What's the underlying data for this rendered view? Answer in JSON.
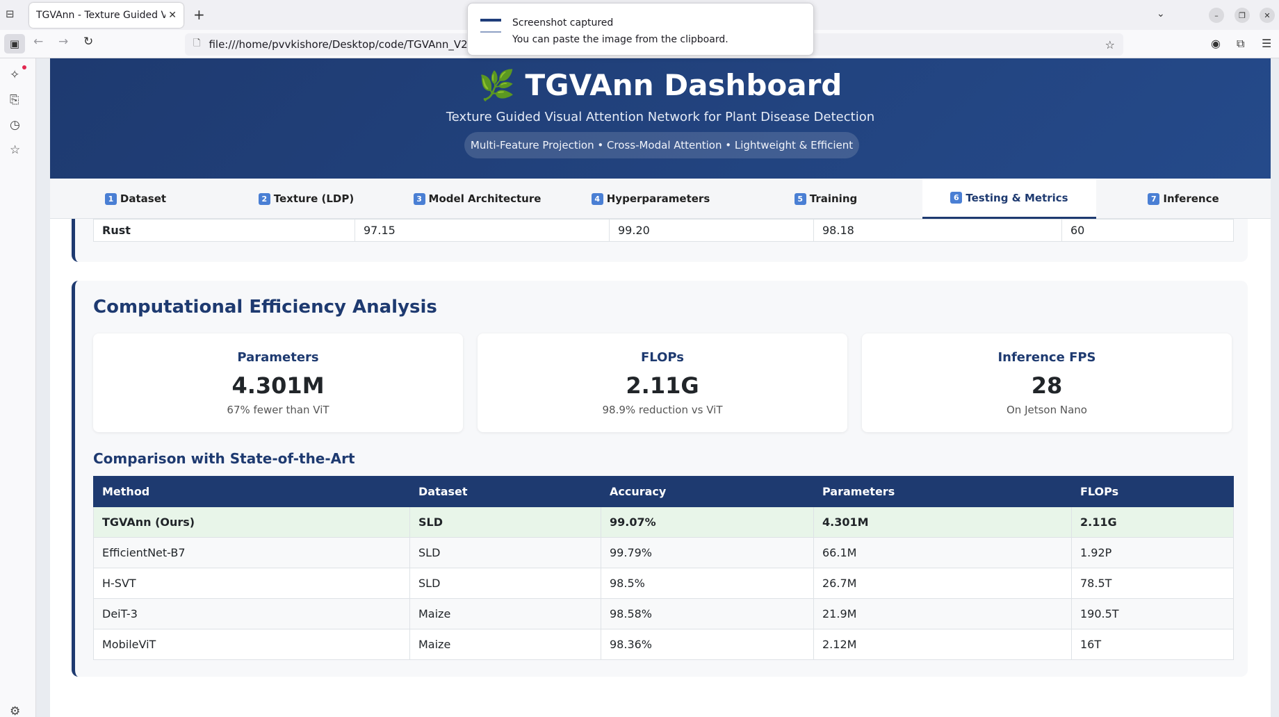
{
  "browser": {
    "tab_title": "TGVAnn - Texture Guided Vis",
    "url": "file:///home/pvvkishore/Desktop/code/TGVAnn_V2_K",
    "icons": [
      "tab-list-icon",
      "close-icon",
      "new-tab-icon",
      "back-icon",
      "forward-icon",
      "reload-icon",
      "page-icon",
      "bookmark-star-icon",
      "account-icon",
      "extensions-icon",
      "menu-icon"
    ]
  },
  "notification": {
    "title": "Screenshot captured",
    "body": "You can paste the image from the clipboard."
  },
  "header": {
    "title": "🌿 TGVAnn Dashboard",
    "subtitle": "Texture Guided Visual Attention Network for Plant Disease Detection",
    "pill": "Multi-Feature Projection • Cross-Modal Attention • Lightweight & Efficient"
  },
  "tabs": [
    {
      "num": "1",
      "label": "Dataset"
    },
    {
      "num": "2",
      "label": "Texture (LDP)"
    },
    {
      "num": "3",
      "label": "Model Architecture"
    },
    {
      "num": "4",
      "label": "Hyperparameters"
    },
    {
      "num": "5",
      "label": "Training"
    },
    {
      "num": "6",
      "label": "Testing & Metrics"
    },
    {
      "num": "7",
      "label": "Inference"
    }
  ],
  "active_tab": "Testing & Metrics",
  "prev_row": {
    "class": "Rust",
    "c1": "97.15",
    "c2": "99.20",
    "c3": "98.18",
    "c4": "60"
  },
  "efficiency": {
    "title": "Computational Efficiency Analysis",
    "cards": [
      {
        "label": "Parameters",
        "value": "4.301M",
        "note": "67% fewer than ViT"
      },
      {
        "label": "FLOPs",
        "value": "2.11G",
        "note": "98.9% reduction vs ViT"
      },
      {
        "label": "Inference FPS",
        "value": "28",
        "note": "On Jetson Nano"
      }
    ]
  },
  "comparison": {
    "title": "Comparison with State-of-the-Art",
    "headers": [
      "Method",
      "Dataset",
      "Accuracy",
      "Parameters",
      "FLOPs"
    ],
    "rows": [
      [
        "TGVAnn (Ours)",
        "SLD",
        "99.07%",
        "4.301M",
        "2.11G"
      ],
      [
        "EfficientNet-B7",
        "SLD",
        "99.79%",
        "66.1M",
        "1.92P"
      ],
      [
        "H-SVT",
        "SLD",
        "98.5%",
        "26.7M",
        "78.5T"
      ],
      [
        "DeiT-3",
        "Maize",
        "98.58%",
        "21.9M",
        "190.5T"
      ],
      [
        "MobileViT",
        "Maize",
        "98.36%",
        "2.12M",
        "16T"
      ]
    ]
  },
  "colors": {
    "primary": "#1e3a70",
    "highlight_row": "#e8f5e9",
    "number_badge": "#4a7fd4"
  }
}
